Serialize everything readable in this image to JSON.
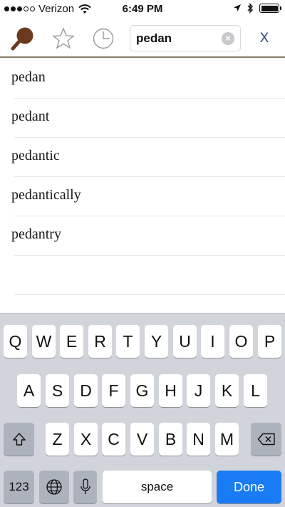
{
  "status_bar": {
    "carrier": "Verizon",
    "time": "6:49 PM"
  },
  "toolbar": {
    "search_value": "pedan",
    "close_label": "X"
  },
  "results": [
    "pedan",
    "pedant",
    "pedantic",
    "pedantically",
    "pedantry"
  ],
  "keyboard": {
    "row1": [
      "Q",
      "W",
      "E",
      "R",
      "T",
      "Y",
      "U",
      "I",
      "O",
      "P"
    ],
    "row2": [
      "A",
      "S",
      "D",
      "F",
      "G",
      "H",
      "J",
      "K",
      "L"
    ],
    "row3": [
      "Z",
      "X",
      "C",
      "V",
      "B",
      "N",
      "M"
    ],
    "numbers_label": "123",
    "space_label": "space",
    "done_label": "Done"
  },
  "colors": {
    "accent": "#6b3a1e",
    "done_key": "#1a7cf5",
    "close_x": "#2c4a7a"
  }
}
